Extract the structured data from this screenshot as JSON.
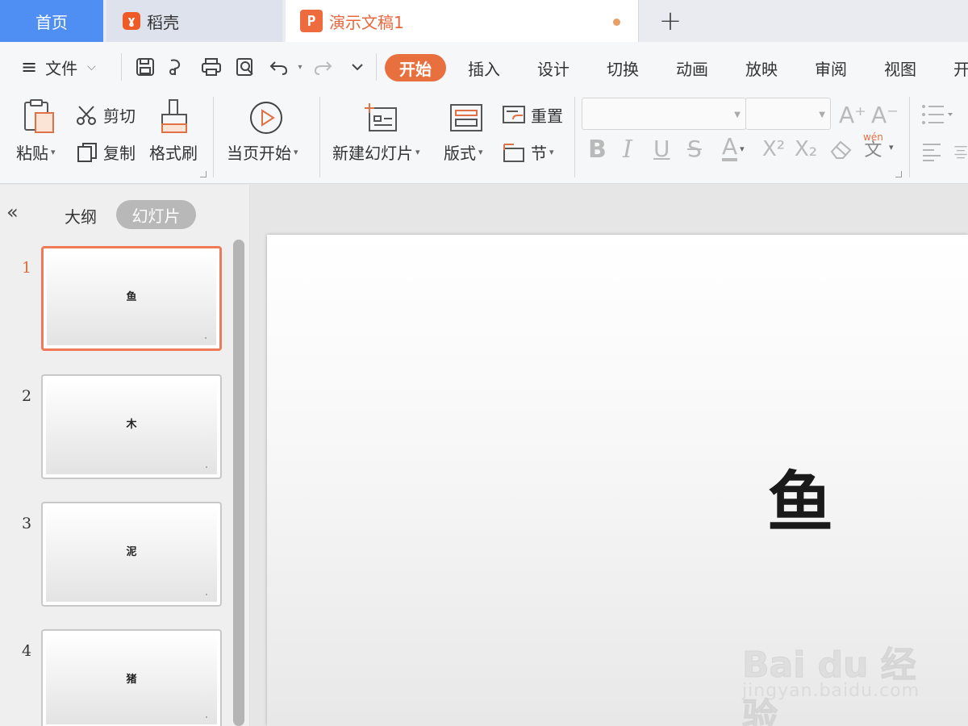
{
  "tabs": {
    "home": "首页",
    "daoke": "稻壳",
    "document": "演示文稿1",
    "new_tab": "+"
  },
  "menu": {
    "file": "文件",
    "ribbon_tabs": [
      "开始",
      "插入",
      "设计",
      "切换",
      "动画",
      "放映",
      "审阅",
      "视图",
      "开"
    ]
  },
  "toolbar": {
    "paste": "粘贴",
    "cut": "剪切",
    "copy": "复制",
    "format_painter": "格式刷",
    "start_from_current": "当页开始",
    "new_slide": "新建幻灯片",
    "layout": "版式",
    "reset": "重置",
    "section": "节",
    "font_name": "",
    "font_size": "",
    "bold": "B",
    "italic": "I",
    "underline": "U",
    "strikethrough": "S",
    "font_color": "A",
    "superscript": "X²",
    "subscript": "X₂",
    "pinyin_top": "wén",
    "pinyin_char": "文",
    "grow_font": "A⁺",
    "shrink_font": "A⁻"
  },
  "left_panel": {
    "collapse": "«",
    "outline_tab": "大纲",
    "slides_tab": "幻灯片",
    "slides": [
      {
        "number": "1",
        "title": "鱼"
      },
      {
        "number": "2",
        "title": "木"
      },
      {
        "number": "3",
        "title": "泥"
      },
      {
        "number": "4",
        "title": "猪"
      }
    ]
  },
  "slide": {
    "title": "鱼"
  },
  "watermark": {
    "brand": "Bai du 经验",
    "sub": "jingyan.baidu.com"
  },
  "colors": {
    "home_tab": "#4f8ef2",
    "accent": "#e8703f",
    "active_thumb_border": "#ef7a57"
  }
}
